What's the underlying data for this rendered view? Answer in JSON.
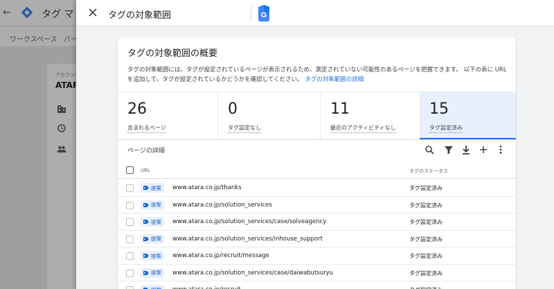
{
  "background": {
    "title": "タグ マ",
    "nav": [
      "ワークスペース",
      "バー"
    ],
    "account_label": "アカウン",
    "account_name": "ATAR"
  },
  "panel": {
    "title": "タグの対象範囲"
  },
  "card": {
    "title": "タグの対象範囲の概要",
    "description": "タグの対象範囲には、タグが設定されているページが表示されるため、測定されていない可能性のあるページを把握できます。 以下の表に URL を追加して、タグが設定されているかどうかを確認してください。",
    "learn_more": "タグの対象範囲の詳細"
  },
  "stats": [
    {
      "value": "26",
      "label": "含まれるページ"
    },
    {
      "value": "0",
      "label": "タグ設定なし"
    },
    {
      "value": "11",
      "label": "最近のアクティビティなし"
    },
    {
      "value": "15",
      "label": "タグ設定済み"
    }
  ],
  "details": {
    "title": "ページの詳細",
    "columns": {
      "url": "URL",
      "status": "タグのステータス"
    }
  },
  "rows": [
    {
      "badge": "提案",
      "url": "www.atara.co.jp/thanks",
      "status": "タグ設定済み"
    },
    {
      "badge": "提案",
      "url": "www.atara.co.jp/solution_services",
      "status": "タグ設定済み"
    },
    {
      "badge": "提案",
      "url": "www.atara.co.jp/solution_services/case/solveagency",
      "status": "タグ設定済み"
    },
    {
      "badge": "提案",
      "url": "www.atara.co.jp/solution_services/inhouse_support",
      "status": "タグ設定済み"
    },
    {
      "badge": "提案",
      "url": "www.atara.co.jp/recruit/message",
      "status": "タグ設定済み"
    },
    {
      "badge": "提案",
      "url": "www.atara.co.jp/solution_services/case/daiwabutsuryu",
      "status": "タグ設定済み"
    },
    {
      "badge": "提案",
      "url": "www.atara.co.jp/recruit",
      "status": "タグ設定済み"
    }
  ],
  "colors": {
    "accent": "#1a73e8",
    "active_bg": "#e8f0fe"
  }
}
